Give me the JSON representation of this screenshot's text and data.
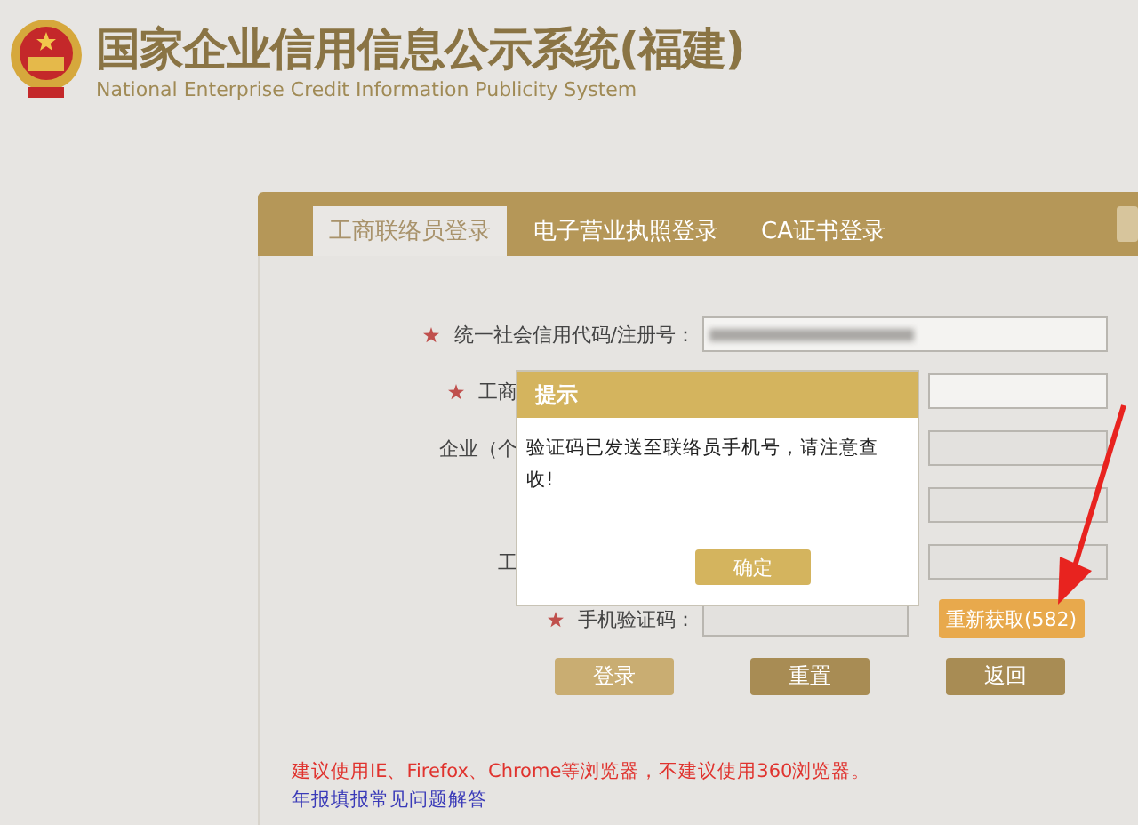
{
  "header": {
    "title": "国家企业信用信息公示系统(福建)",
    "subtitle": "National Enterprise Credit Information Publicity System"
  },
  "tabs": [
    {
      "label": "工商联络员登录",
      "selected": true
    },
    {
      "label": "电子营业执照登录",
      "selected": false
    },
    {
      "label": "CA证书登录",
      "selected": false
    }
  ],
  "form": {
    "rows": [
      {
        "kind": "open",
        "required": true,
        "label": "统一社会信用代码/注册号：",
        "disabled": false,
        "blurred": true
      },
      {
        "kind": "covered",
        "required": true,
        "label": "工商",
        "disabled": false
      },
      {
        "kind": "covered",
        "required": false,
        "label": "企业（个",
        "disabled": true
      },
      {
        "kind": "covered",
        "required": false,
        "label": "",
        "disabled": true
      },
      {
        "kind": "covered",
        "required": false,
        "label": "工",
        "disabled": true
      },
      {
        "kind": "open",
        "required": true,
        "label": "手机验证码：",
        "disabled": true,
        "action": "重新获取(582)"
      }
    ],
    "buttons": [
      {
        "label": "登录",
        "disabled": true
      },
      {
        "label": "重置",
        "disabled": false
      },
      {
        "label": "返回",
        "disabled": false
      }
    ]
  },
  "notice": "建议使用IE、Firefox、Chrome等浏览器，不建议使用360浏览器。",
  "faq_link": "年报填报常见问题解答",
  "dialog": {
    "title": "提示",
    "message": "验证码已发送至联络员手机号，请注意查收!",
    "button": "确定"
  }
}
